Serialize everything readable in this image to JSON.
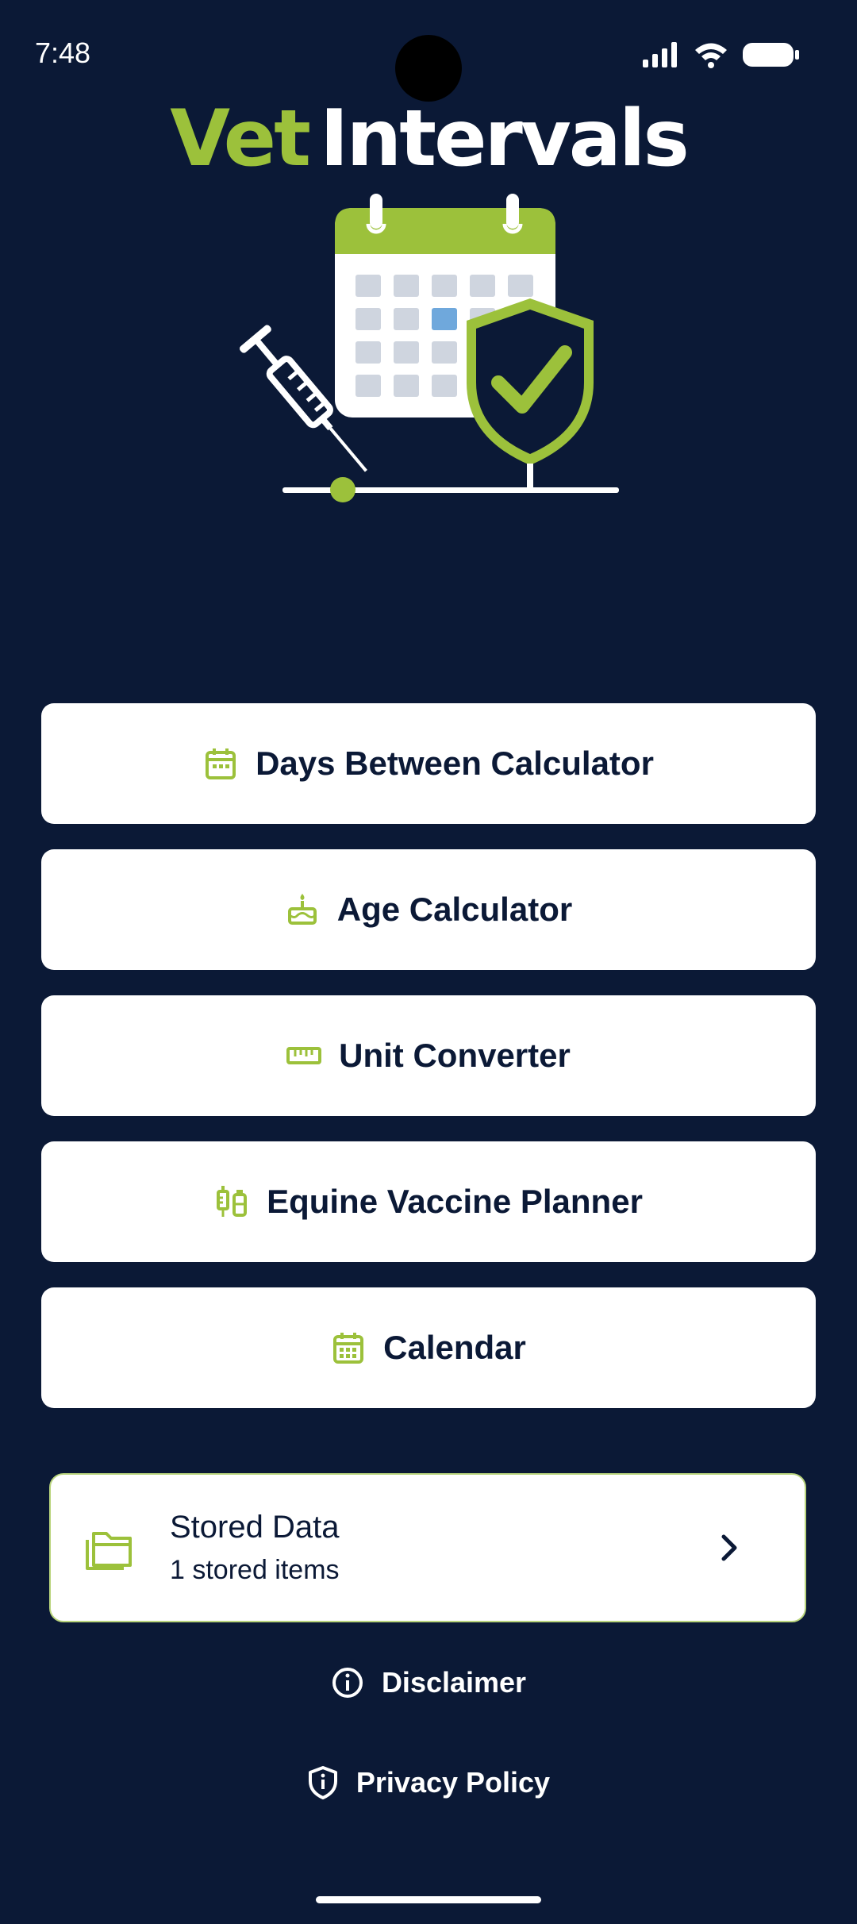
{
  "status_bar": {
    "time": "7:48"
  },
  "logo": {
    "part1": "Vet",
    "part2": "Intervals"
  },
  "menu": [
    {
      "label": "Days Between Calculator",
      "icon": "calendar-icon"
    },
    {
      "label": "Age Calculator",
      "icon": "cake-icon"
    },
    {
      "label": "Unit Converter",
      "icon": "ruler-icon"
    },
    {
      "label": "Equine Vaccine Planner",
      "icon": "vaccine-icon"
    },
    {
      "label": "Calendar",
      "icon": "calendar-month-icon"
    }
  ],
  "stored": {
    "title": "Stored Data",
    "subtitle": "1 stored items",
    "icon": "folder-icon"
  },
  "links": {
    "disclaimer": "Disclaimer",
    "privacy": "Privacy Policy"
  },
  "colors": {
    "background": "#0b1936",
    "accent": "#9cc13b",
    "card": "#ffffff",
    "text_dark": "#0b1936"
  }
}
